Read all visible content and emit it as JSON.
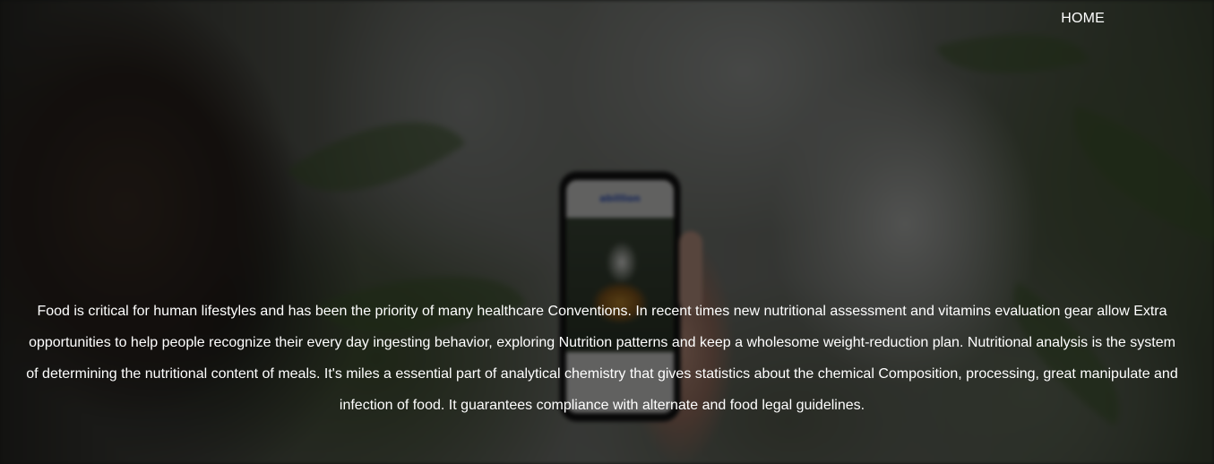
{
  "nav": {
    "home_label": "HOME"
  },
  "hero": {
    "background_image": "blurred photo of hand holding smartphone showing food app among plants",
    "phone_app_logo": "abillion",
    "description": "Food is critical for human lifestyles and has been the priority of many healthcare Conventions. In recent times new nutritional assessment and vitamins evaluation gear allow Extra opportunities to help people recognize their every day ingesting behavior, exploring Nutrition patterns and keep a wholesome weight-reduction plan. Nutritional analysis is the system of determining the nutritional content of meals. It's miles a essential part of analytical chemistry that gives statistics about the chemical Composition, processing, great manipulate and infection of food. It guarantees compliance with alternate and food legal guidelines."
  },
  "colors": {
    "text": "#ffffff",
    "overlay": "rgba(0,0,0,0.55)"
  }
}
